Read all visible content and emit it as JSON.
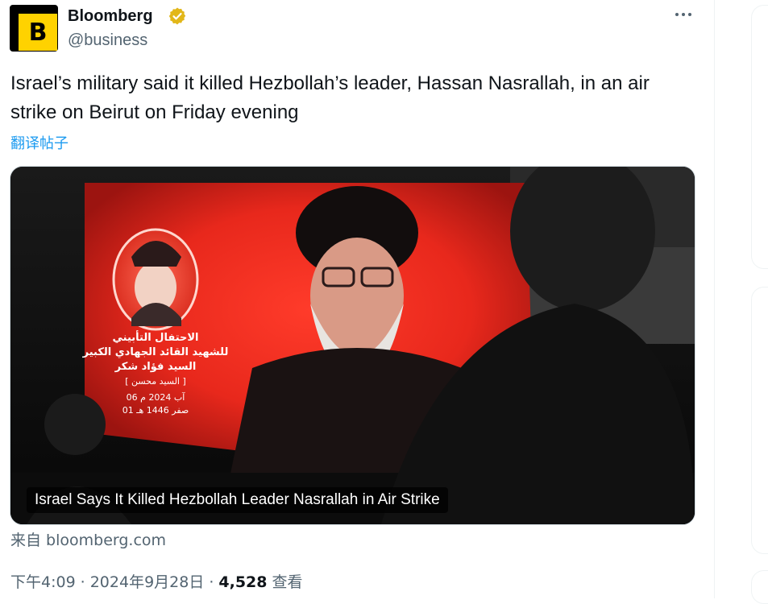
{
  "author": {
    "name": "Bloomberg",
    "handle": "@business",
    "avatar_letter": "B",
    "avatar_color": "#ffd200",
    "verified_color": "#e2b719"
  },
  "tweet": {
    "text": "Israel’s military said it killed Hezbollah’s leader, Hassan Nasrallah, in an air strike on Beirut on Friday evening",
    "translate_label": "翻译帖子"
  },
  "media": {
    "caption": "Israel Says It Killed Hezbollah Leader Nasrallah in Air Strike",
    "source_label": "来自 bloomberg.com",
    "poster_text": "الاحتفال التأبيني للشهيد القائد الجهادي الكبير السيد فؤاد شكر",
    "poster_subtext": "[ السيد محسن ]",
    "poster_dates": [
      "06 آب 2024 م",
      "01 صفر 1446 هـ"
    ]
  },
  "meta": {
    "time": "下午4:09",
    "date": "2024年9月28日",
    "separator": "·",
    "views_count": "4,528",
    "views_label": "查看"
  },
  "colors": {
    "link": "#1d9bf0",
    "secondary_text": "#536471",
    "primary_text": "#0f1419"
  }
}
